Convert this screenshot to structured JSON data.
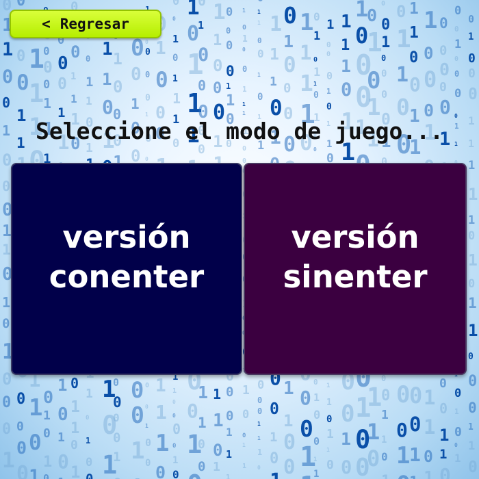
{
  "back_button": {
    "icon": "chevron-left-icon",
    "chevron": "<",
    "label": "Regresar"
  },
  "prompt": "Seleccione el modo de juego...",
  "modes": [
    {
      "line1": "versión",
      "line2": "conenter",
      "color": "#01004a"
    },
    {
      "line1": "versión",
      "line2": "sinenter",
      "color": "#3b0040"
    }
  ],
  "background": {
    "description_icon": "binary-code-background",
    "accent": "#1a5fb4"
  }
}
